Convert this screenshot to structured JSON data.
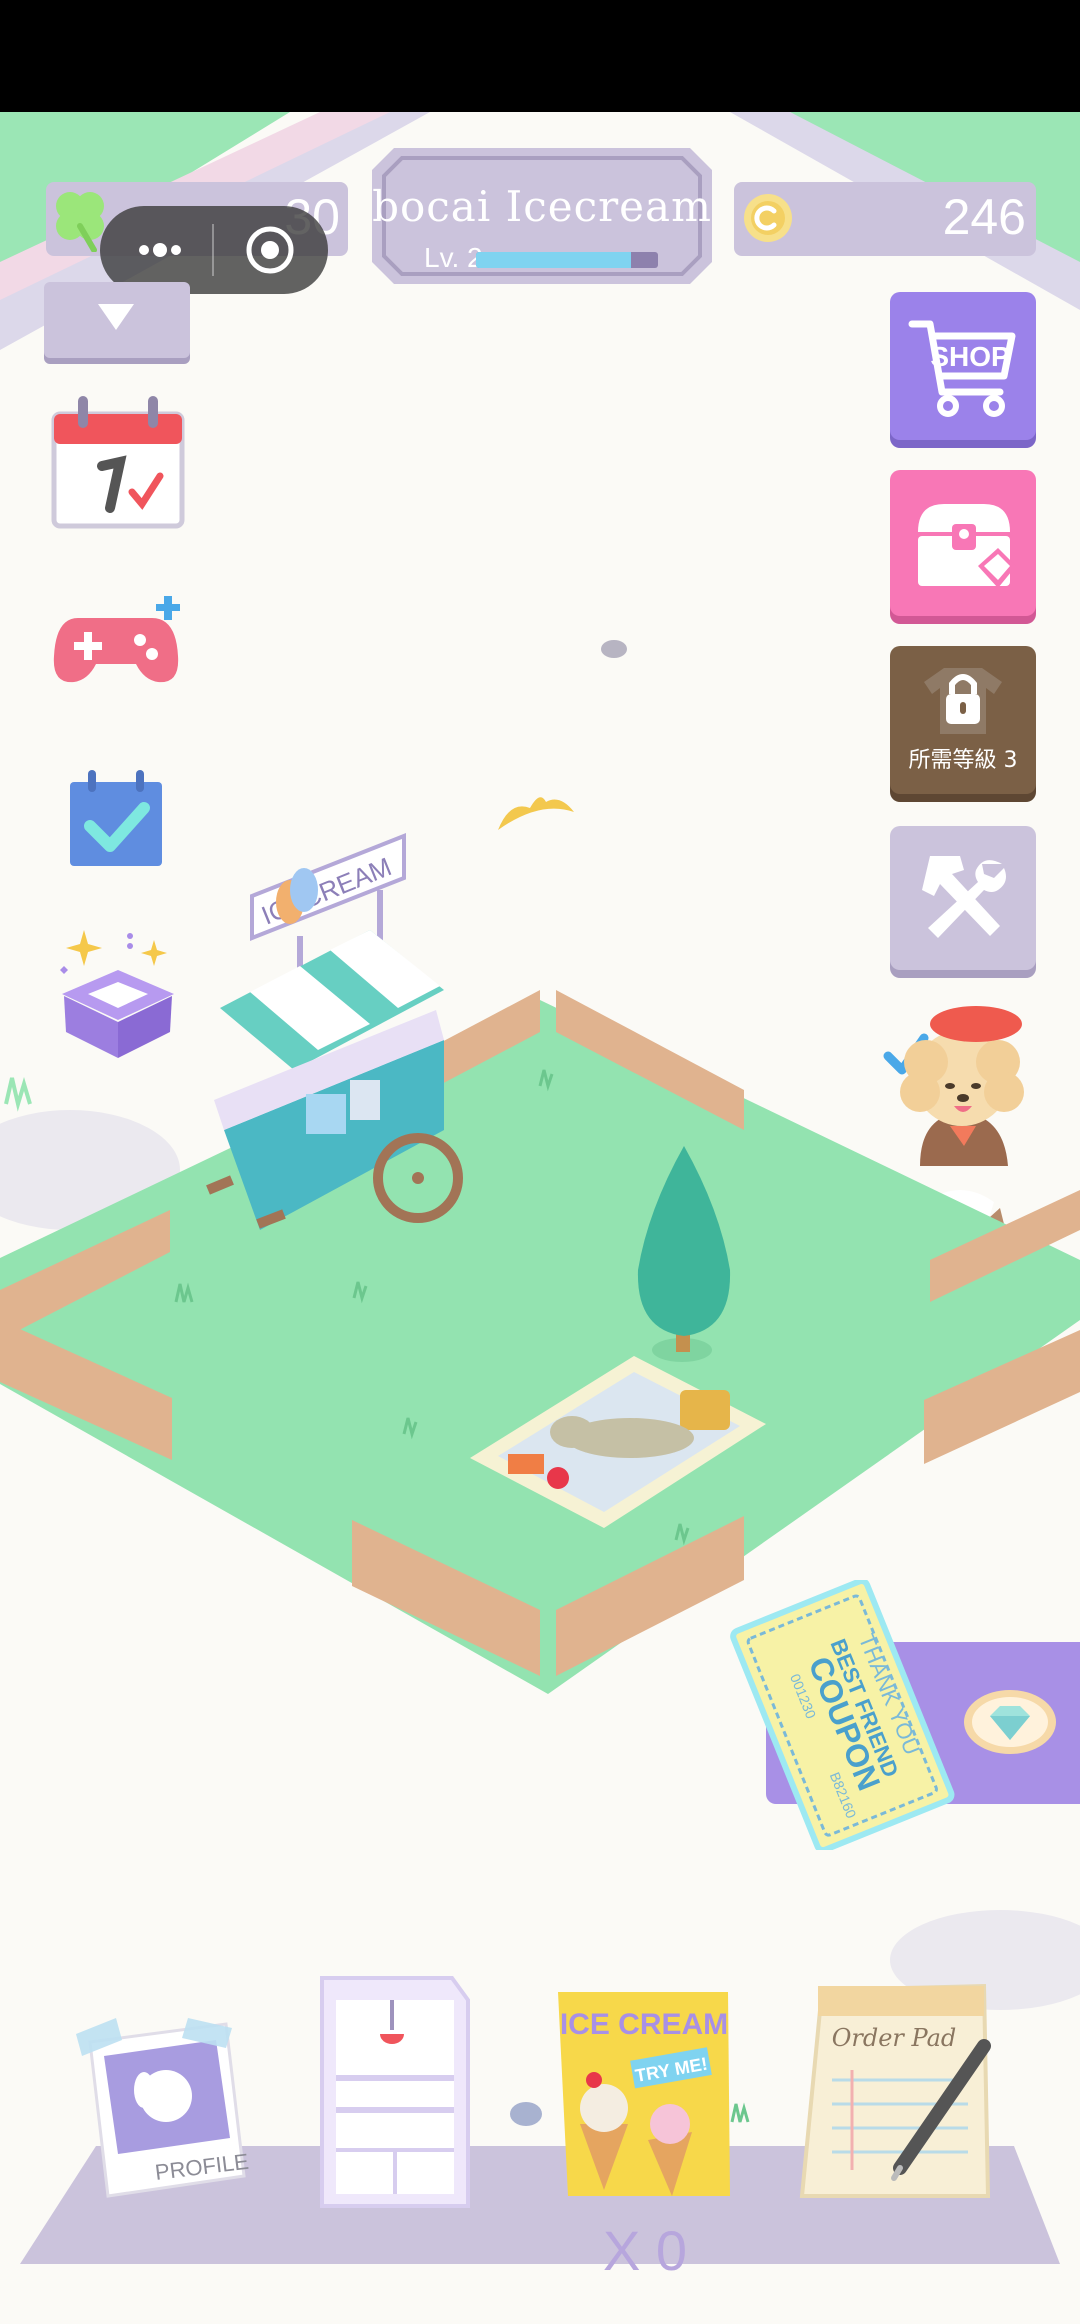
{
  "hud": {
    "clover_count": "30",
    "shop_title": "bocai Icecream",
    "level_label": "Lv. 2",
    "xp_progress": 0.85,
    "coin_count": "246"
  },
  "right_menu": {
    "shop_label": "SHOP",
    "locked_label": "所需等級 3"
  },
  "scene": {
    "stand_sign": "ICECREAM"
  },
  "coupon": {
    "line1": "THANK YOU",
    "line2": "BEST FRIEND",
    "line3": "COUPON",
    "serial_top": "001230",
    "serial_bottom": "B82160"
  },
  "shelf": {
    "profile_label": "PROFILE",
    "poster_title": "ICE CREAM",
    "poster_tag": "TRY ME!",
    "orderpad_label": "Order Pad",
    "ice_count": "X 0"
  },
  "colors": {
    "hud_pill": "#cbc3dc",
    "grass": "#93e3b0",
    "fence": "#e0b38f",
    "shop_button": "#9b82ea",
    "chest_button": "#f877b6",
    "locked_button": "#7b6046",
    "shelf": "#cbc3dc"
  }
}
